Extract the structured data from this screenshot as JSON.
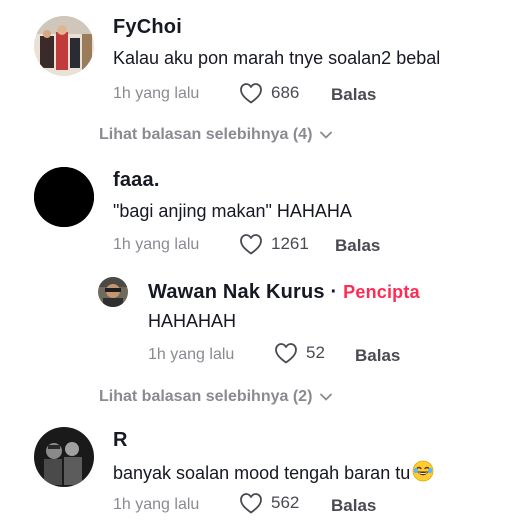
{
  "comments": [
    {
      "username": "FyChoi",
      "text": "Kalau aku pon marah tnye soalan2 bebal",
      "time": "1h yang lalu",
      "likes": "686",
      "reply_label": "Balas",
      "view_more": "Lihat balasan selebihnya (4)"
    },
    {
      "username": "faaa.",
      "text": "\"bagi anjing makan\" HAHAHA",
      "time": "1h yang lalu",
      "likes": "1261",
      "reply_label": "Balas",
      "reply": {
        "username": "Wawan Nak Kurus",
        "separator": "·",
        "creator_label": "Pencipta",
        "text": "HAHAHAH",
        "time": "1h yang lalu",
        "likes": "52",
        "reply_label": "Balas"
      },
      "view_more": "Lihat balasan selebihnya (2)"
    },
    {
      "username": "R",
      "text": "banyak soalan mood tengah baran tu",
      "time": "1h yang lalu",
      "likes": "562",
      "reply_label": "Balas"
    }
  ],
  "colors": {
    "creator": "#fe2c55",
    "meta": "#8a8b91"
  },
  "icons": {
    "like": "heart-outline-icon",
    "expand": "chevron-down-icon",
    "emoji": "laughing-tears-emoji"
  }
}
